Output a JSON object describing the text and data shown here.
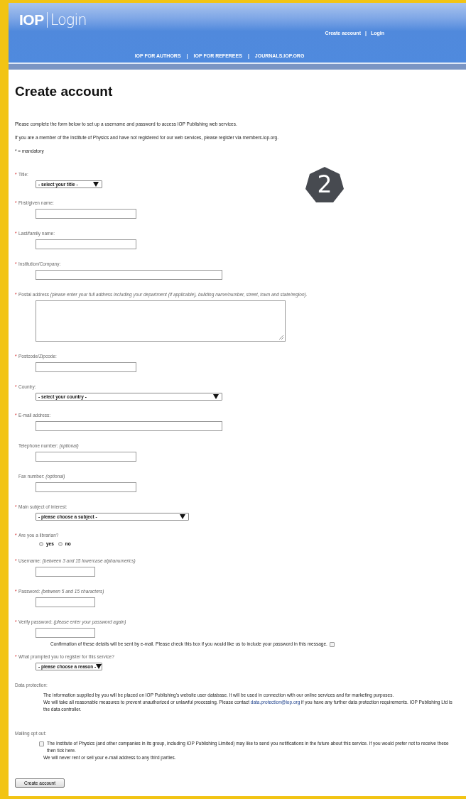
{
  "header": {
    "logo_mark": "IOP",
    "logo_text": "Login",
    "account_links": [
      "Create account",
      "Login"
    ],
    "separator": "|",
    "nav": [
      "IOP FOR AUTHORS",
      "IOP FOR REFEREES",
      "JOURNALS.IOP.ORG"
    ]
  },
  "page_title": "Create account",
  "intro": [
    "Please complete the form below to set up a username and password to access IOP Publishing web services.",
    "If you are a member of the Institute of Physics and have not registered for our web services, please register via members.iop.org.",
    "* = mandatory"
  ],
  "step_badge": "2",
  "required_mark": "*",
  "fields": [
    {
      "kind": "short_select",
      "label": "Title:",
      "required": true,
      "value": "- select your title -"
    },
    {
      "kind": "text",
      "label": "First/given name:",
      "required": true
    },
    {
      "kind": "text",
      "label": "Last/family name:",
      "required": true
    },
    {
      "kind": "long_text",
      "label": "Institution/Company:",
      "required": true
    },
    {
      "kind": "textarea",
      "label": "Postal address",
      "hint": "(please enter your full address including your department (if applicable), building name/number, street, town and state/region).",
      "required": true
    },
    {
      "kind": "text",
      "label": "Postcode/Zipcode:",
      "required": true
    },
    {
      "kind": "long_select",
      "label": "Country:",
      "required": true,
      "value": "- select your country -"
    },
    {
      "kind": "long_text",
      "label": "E-mail address:",
      "required": true
    },
    {
      "kind": "text",
      "label": "Telephone number:",
      "hint": "(optional)",
      "required": false
    },
    {
      "kind": "text",
      "label": "Fax number:",
      "hint": "(optional)",
      "required": false
    },
    {
      "kind": "wide_select",
      "label": "Main subject of interest:",
      "required": true,
      "value": "- please choose a subject -"
    },
    {
      "kind": "radio",
      "label": "Are you a librarian?",
      "required": true,
      "options": [
        {
          "label": "yes",
          "selected": false
        },
        {
          "label": "no",
          "selected": false
        }
      ]
    },
    {
      "kind": "short_text",
      "label": "Username:",
      "hint": "(between 3 and 15 lowercase alphanumerics)",
      "required": true
    },
    {
      "kind": "short_text",
      "label": "Password:",
      "hint": "(between 5 and 15 characters)",
      "required": true
    },
    {
      "kind": "short_text",
      "label": "Verify password:",
      "hint": "(please enter your password again)",
      "required": true,
      "note": "Confirmation of these details will be sent by e-mail. Please check this box if you would like us to include your password in this message.",
      "note_checked": false
    },
    {
      "kind": "short_select",
      "label": "What prompted you to register for this service?",
      "required": true,
      "value": "- please choose a reason -"
    }
  ],
  "data_protection": {
    "heading": "Data protection:",
    "paragraphs": [
      {
        "text": "The information supplied by you will be placed on IOP Publishing's website user database. It will be used in connection with our online services and for marketing purposes."
      },
      {
        "text": "We will take all reasonable measures to prevent unauthorized or unlawful processing. Please contact",
        "link": "data.protection@iop.org",
        "after": "if you have any further data protection requirements. IOP Publishing Ltd is the data controller."
      }
    ]
  },
  "mailing": {
    "heading": "Mailing opt out:",
    "checked": false,
    "text": "The Institute of Physics (and other companies in its group, including IOP Publishing Limited) may like to send you notifications in the future about this service. If you would prefer not to receive these then tick here.",
    "note": "We will never rent or sell your e-mail address to any third parties."
  },
  "submit": "Create account"
}
